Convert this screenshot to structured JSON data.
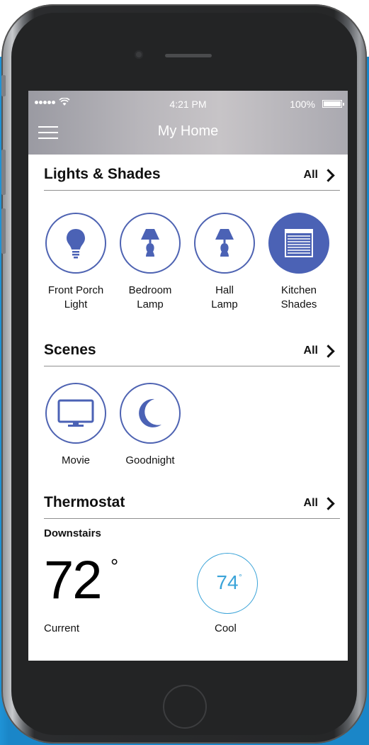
{
  "status_bar": {
    "time": "4:21 PM",
    "battery": "100%"
  },
  "header": {
    "title": "My Home"
  },
  "sections": {
    "lights": {
      "title": "Lights & Shades",
      "all_label": "All",
      "devices": [
        {
          "label": "Front Porch\nLight",
          "icon": "bulb-icon"
        },
        {
          "label": "Bedroom\nLamp",
          "icon": "lamp-icon"
        },
        {
          "label": "Hall\nLamp",
          "icon": "lamp-icon"
        },
        {
          "label": "Kitchen\nShades",
          "icon": "shades-icon",
          "active": true
        }
      ]
    },
    "scenes": {
      "title": "Scenes",
      "all_label": "All",
      "items": [
        {
          "label": "Movie",
          "icon": "tv-icon"
        },
        {
          "label": "Goodnight",
          "icon": "moon-icon"
        }
      ]
    },
    "thermostat": {
      "title": "Thermostat",
      "all_label": "All",
      "zone": "Downstairs",
      "current_temp": "72",
      "current_label": "Current",
      "setpoint": "74",
      "mode_label": "Cool"
    }
  },
  "colors": {
    "accent": "#4b62b5",
    "thermo": "#3aa3d8",
    "background": "#1a86c8"
  }
}
